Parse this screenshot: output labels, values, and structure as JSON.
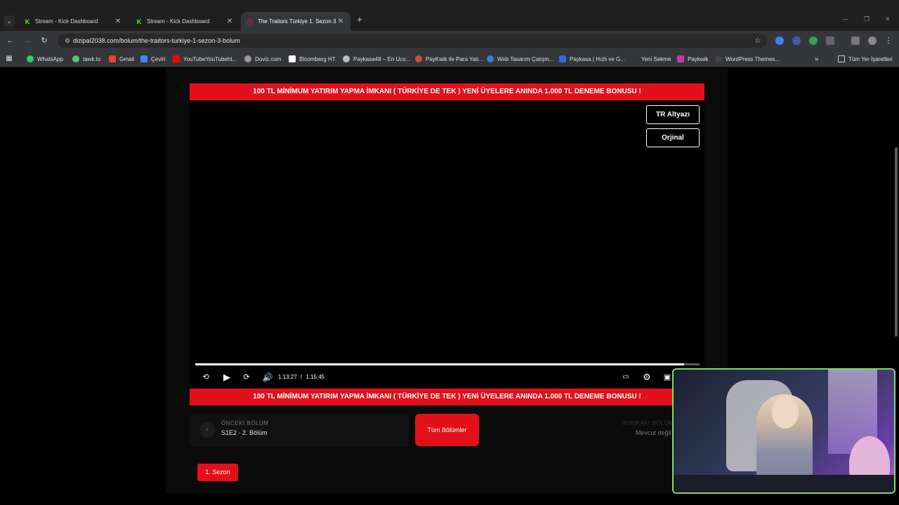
{
  "browser": {
    "tabs": [
      {
        "label": "Stream - Kick Dashboard",
        "favicon": "kick-logo"
      },
      {
        "label": "Stream - Kick Dashboard",
        "favicon": "kick-logo"
      },
      {
        "label": "The Traitors Türkiye 1. Sezon 3",
        "favicon": "dizipal-logo",
        "active": true
      }
    ],
    "url": "dizipal2038.com/bolum/the-traitors-turkiye-1-sezon-3-bolum",
    "bookmarks": [
      "WhatsApp",
      "tawk.to",
      "Gmail",
      "Çeviri",
      "YouTubeYouTubeht...",
      "Doviz.com",
      "Bloomberg HT",
      "Paykasa48 – En Ucu...",
      "PayKwik ile Para Yatı...",
      "Web Tasarım Çalışm...",
      "Paykasa | Hızlı ve G...",
      "Yeni Sekme",
      "Paykwik",
      "WordPress Themes..."
    ],
    "all_bookmarks": "Tüm Yer İşaretleri"
  },
  "banner_text": "100 TL MİNİMUM YATIRIM YAPMA İMKANI ( TÜRKİYE DE TEK ) YENİ ÜYELERE ANINDA 1.000 TL DENEME BONUSU !",
  "player": {
    "subtitle_button": "TR Altyazı",
    "original_button": "Orjinal",
    "current_time": "1:13:27",
    "separator": "/",
    "duration": "1:15:45",
    "progress_fraction": 0.97
  },
  "episode_nav": {
    "prev_label": "ÖNCEKİ BÖLÜM",
    "prev_value": "S1E2 · 2. Bölüm",
    "all_episodes": "Tüm Bölümler",
    "next_label": "SONRAKİ BÖLÜM",
    "next_value": "Mevcut değil"
  },
  "season_button": "1. Sezon",
  "colors": {
    "accent": "#e3101b",
    "webcam_border": "#7ddc6a",
    "kick_green": "#53fc18"
  }
}
